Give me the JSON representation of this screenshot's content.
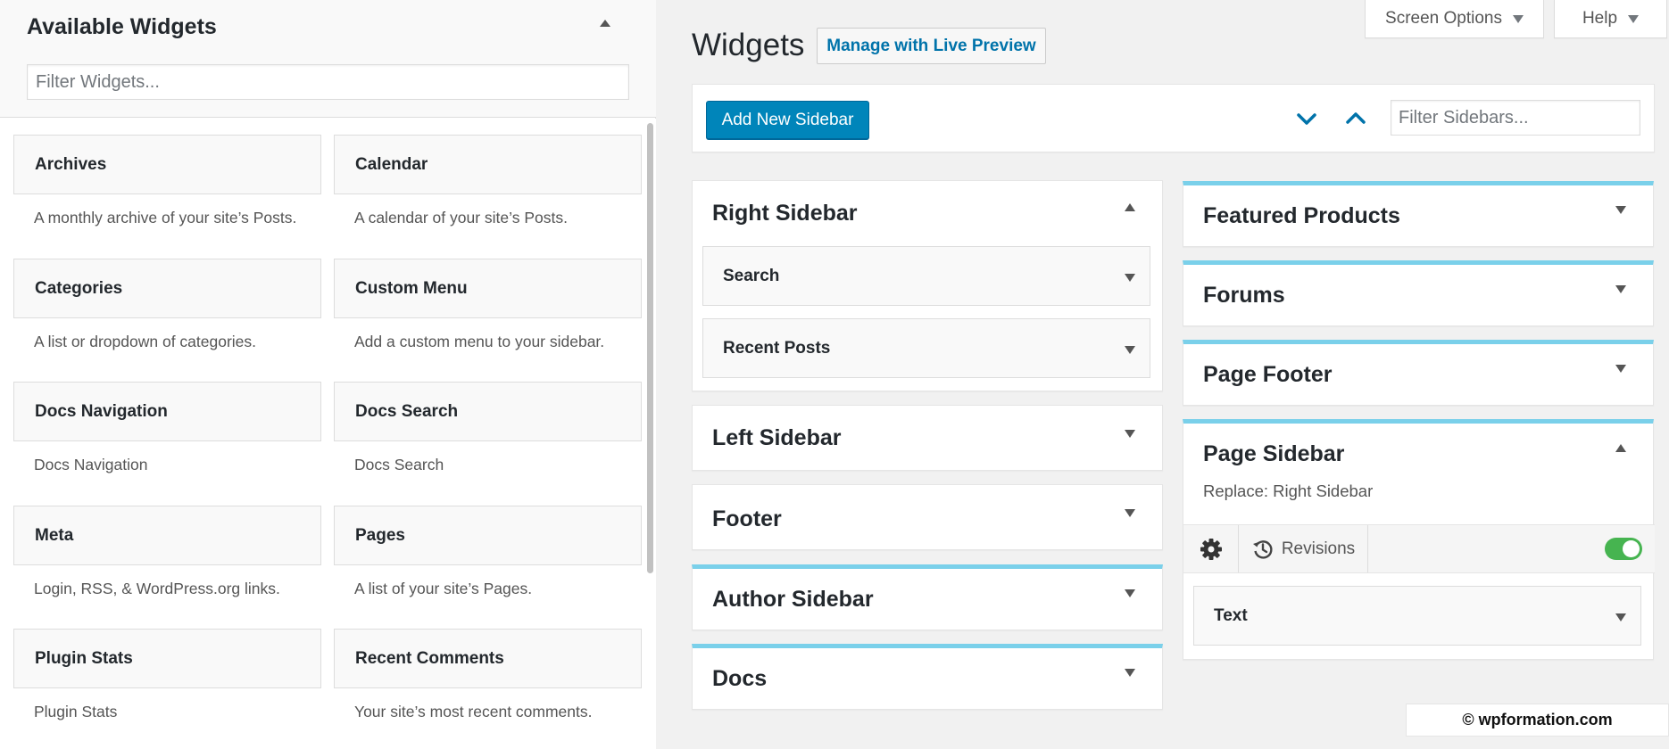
{
  "available_widgets": {
    "title": "Available Widgets",
    "filter_placeholder": "Filter Widgets...",
    "widgets": [
      {
        "name": "Archives",
        "description": "A monthly archive of your site’s Posts."
      },
      {
        "name": "Calendar",
        "description": "A calendar of your site’s Posts."
      },
      {
        "name": "Categories",
        "description": "A list or dropdown of categories."
      },
      {
        "name": "Custom Menu",
        "description": "Add a custom menu to your sidebar."
      },
      {
        "name": "Docs Navigation",
        "description": "Docs Navigation"
      },
      {
        "name": "Docs Search",
        "description": "Docs Search"
      },
      {
        "name": "Meta",
        "description": "Login, RSS, & WordPress.org links."
      },
      {
        "name": "Pages",
        "description": "A list of your site’s Pages."
      },
      {
        "name": "Plugin Stats",
        "description": "Plugin Stats"
      },
      {
        "name": "Recent Comments",
        "description": "Your site’s most recent comments."
      }
    ]
  },
  "screen_meta": {
    "screen_options_label": "Screen Options",
    "help_label": "Help"
  },
  "header": {
    "title": "Widgets",
    "live_preview_label": "Manage with Live Preview"
  },
  "toolbar": {
    "add_sidebar_label": "Add New Sidebar",
    "filter_sidebars_placeholder": "Filter Sidebars..."
  },
  "sidebars_left": [
    {
      "title": "Right Sidebar",
      "expanded": true,
      "accent": false,
      "widgets": [
        "Search",
        "Recent Posts"
      ]
    },
    {
      "title": "Left Sidebar",
      "expanded": false,
      "accent": false
    },
    {
      "title": "Footer",
      "expanded": false,
      "accent": false
    },
    {
      "title": "Author Sidebar",
      "expanded": false,
      "accent": true
    },
    {
      "title": "Docs",
      "expanded": false,
      "accent": true
    }
  ],
  "sidebars_right": [
    {
      "title": "Featured Products",
      "expanded": false,
      "accent": true
    },
    {
      "title": "Forums",
      "expanded": false,
      "accent": true
    },
    {
      "title": "Page Footer",
      "expanded": false,
      "accent": true
    },
    {
      "title": "Page Sidebar",
      "expanded": true,
      "accent": true,
      "replace_text": "Replace: Right Sidebar",
      "revisions_label": "Revisions",
      "enabled": true,
      "widgets": [
        "Text"
      ]
    }
  ],
  "watermark": "© wpformation.com",
  "colors": {
    "accent_bar": "#7ad0ea",
    "primary_button": "#0085ba",
    "link": "#0073aa",
    "toggle_on": "#46b450"
  }
}
